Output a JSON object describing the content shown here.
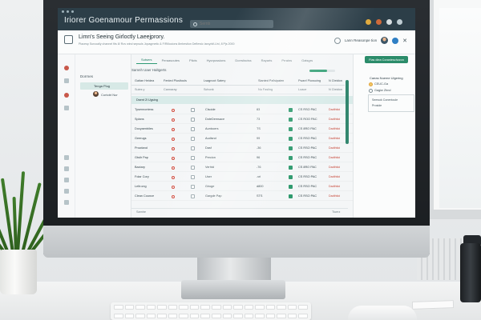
{
  "app": {
    "title": "Iriorer Goenamour Permassions",
    "search_placeholder": "Sernb"
  },
  "header": {
    "title": "Limn's Seeing Girloctly Laeejprory.",
    "subtitle": "Placesp Surcoally channel fits 8/ Rov wind sepsuls Jopagrnetic & F/Rillocions 8mbestion Deflersic larcy/sfi-Unl, 8 Pjs 2000",
    "user_label": "Lann Reasonpe tion"
  },
  "tabs": [
    "Sutsers",
    "Peraasoutes",
    "Plicts",
    "Hycrpcssions",
    "Dorrsfactss",
    "Rayarts",
    "Prrains",
    "Gatsgrs"
  ],
  "sidebar": {
    "section": "Dorrnes",
    "selected": "Tenga Plug",
    "item": "Cortobt Nur"
  },
  "main": {
    "panel_title": "Samnh Uaer Haltgerts",
    "columns": [
      "Gaitan Heidea",
      "Fenled Plusltouls",
      "Lsagnoct Satery",
      "Sianted Pal'sipaien",
      "Pwanf Plussuing",
      "N Cteidon"
    ],
    "filters": [
      "Suies y",
      "Cannaray",
      "Schonk",
      "Nu Fasling",
      "Loace",
      "N Cteidon"
    ],
    "selected_row": "Dsent 2l Ugsing",
    "rows": [
      {
        "name": "Tysennontess",
        "cat": "Clsoide",
        "num": "83",
        "date": "CS RSO PAC",
        "status": "Dadthtioi"
      },
      {
        "name": "Splans",
        "cat": "DoteDemsace",
        "num": "73",
        "date": "CS ROO PAC",
        "status": "Dadthtioi"
      },
      {
        "name": "Docyaenbiles",
        "cat": "Auntoorrs",
        "num": "TS",
        "date": "CS 8RO PAC",
        "status": "Dadthtioi"
      },
      {
        "name": "Geerugs",
        "cat": "Audisnd",
        "num": "99",
        "date": "CS RSO PAC",
        "status": "Dadthtioi"
      },
      {
        "name": "Prowland",
        "cat": "Dasf",
        "num": "-36",
        "date": "CS RSO PAC",
        "status": "Dadthtioi"
      },
      {
        "name": "Gtstlr Pap",
        "cat": "Precion",
        "num": "96",
        "date": "CS RSO PAC",
        "status": "Dadthtioi"
      },
      {
        "name": "Bactary",
        "cat": "Verhtd",
        "num": "-76",
        "date": "CS 8RO PAC",
        "status": "Dadthtioi"
      },
      {
        "name": "Folar Cory",
        "cat": "User",
        "num": "-vri",
        "date": "CS RSO PAC",
        "status": "Dadthtioi"
      },
      {
        "name": "Lelb:ong",
        "cat": "Grioge",
        "num": "d800",
        "date": "CS RSO PAC",
        "status": "Dadthtioi"
      },
      {
        "name": "Clean Counce",
        "cat": "Gargde Pap",
        "num": "STS",
        "date": "CS RSO PAC",
        "status": "Dadthtioi"
      }
    ],
    "footer_left": "Samhe",
    "footer_right": "Tiuerz"
  },
  "right_panel": {
    "button": "Flas diea Coranieschzzon",
    "heading": "Caeas Nueme Ulgering",
    "options": [
      "CEUC-Ga",
      "Gagiw Zhnd"
    ],
    "box_lines": [
      "Seewok Conentoule",
      "Proside"
    ]
  },
  "progress_value": 0.7,
  "colors": {
    "titlebar": "#2c3e48",
    "accent": "#2b8c6a",
    "selected_row": "#d9ebe9",
    "status_red": "#c74638"
  }
}
